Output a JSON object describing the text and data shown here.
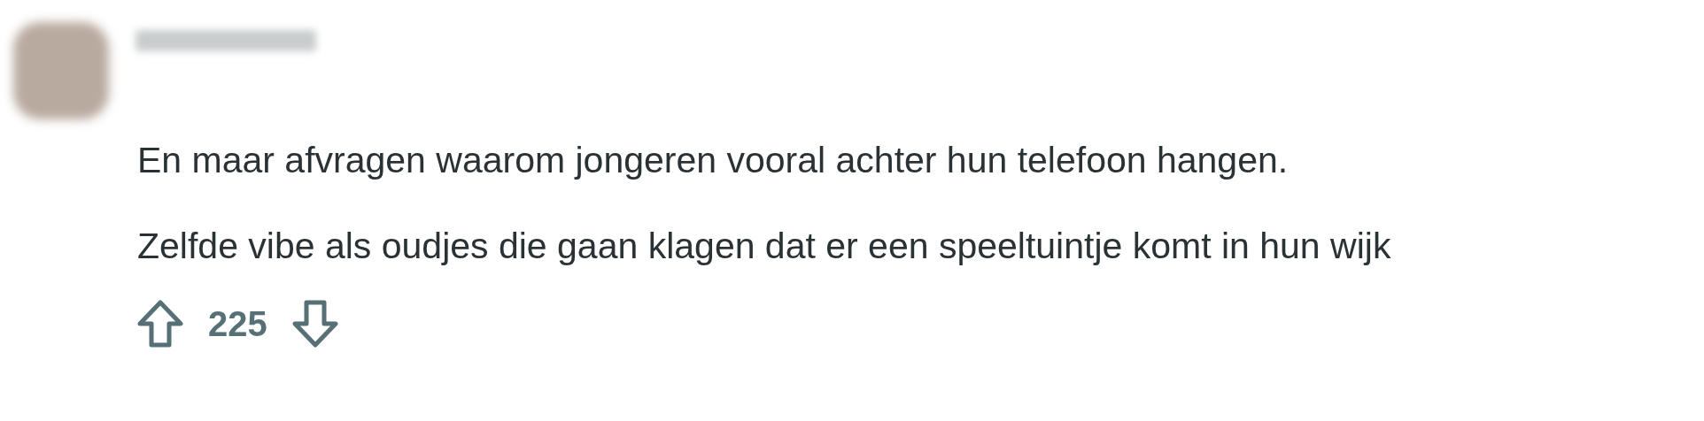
{
  "comment": {
    "body": [
      "En maar afvragen waarom jongeren vooral achter hun telefoon hangen.",
      "Zelfde vibe als oudjes die gaan klagen dat er een speeltuintje komt in hun wijk"
    ],
    "votes": {
      "score": "225"
    }
  }
}
